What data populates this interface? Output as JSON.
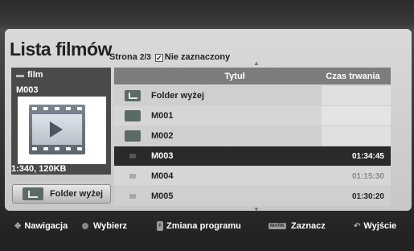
{
  "header": {
    "title": "Lista filmów",
    "page_prefix": "Strona ",
    "page_num": "2/3",
    "checkbox_label": "Nie zaznaczony"
  },
  "left": {
    "folder_label": "film",
    "current_item": "M003",
    "file_info": "1:340, 120KB",
    "folder_up_button": "Folder wyżej"
  },
  "list": {
    "columns": [
      "Tytuł",
      "Czas trwania"
    ],
    "rows": [
      {
        "name": "Folder wyżej",
        "duration": "",
        "type": "folder-up"
      },
      {
        "name": "M001",
        "duration": "",
        "type": "folder"
      },
      {
        "name": "M002",
        "duration": "",
        "type": "folder"
      },
      {
        "name": "M003",
        "duration": "01:34:45",
        "type": "file",
        "selected": true
      },
      {
        "name": "M004",
        "duration": "01:15:30",
        "type": "file"
      },
      {
        "name": "M005",
        "duration": "01:30:20",
        "type": "file"
      }
    ]
  },
  "footer": {
    "navigate": "Nawigacja",
    "select": "Wybierz",
    "program": "Zmiana programu",
    "mark_key": "MARK",
    "mark": "Zaznacz",
    "exit": "Wyjście"
  }
}
